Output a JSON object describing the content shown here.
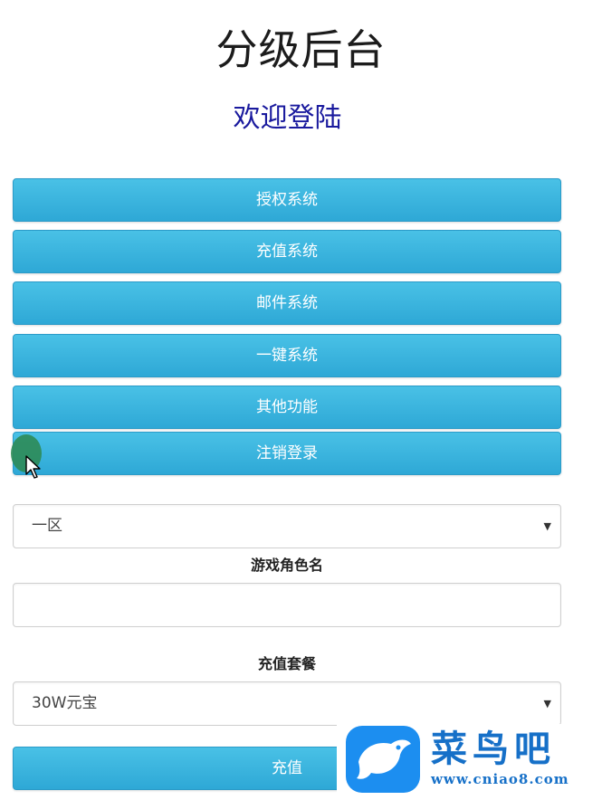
{
  "header": {
    "title": "分级后台",
    "subtitle": "欢迎登陆"
  },
  "menu": {
    "items": [
      {
        "label": "授权系统"
      },
      {
        "label": "充值系统"
      },
      {
        "label": "邮件系统"
      },
      {
        "label": "一键系统"
      },
      {
        "label": "其他功能"
      },
      {
        "label": "注销登录"
      }
    ]
  },
  "form": {
    "server_select": {
      "value": "一区"
    },
    "role_name": {
      "label": "游戏角色名",
      "value": "",
      "placeholder": ""
    },
    "package": {
      "label": "充值套餐",
      "value": "30W元宝"
    },
    "submit_label": "充值"
  },
  "watermark": {
    "brand": "菜鸟吧",
    "url": "www.cniao8.com"
  },
  "colors": {
    "button": "#35afdc",
    "subtitle": "#1a1a9e",
    "brand": "#1670c8"
  }
}
